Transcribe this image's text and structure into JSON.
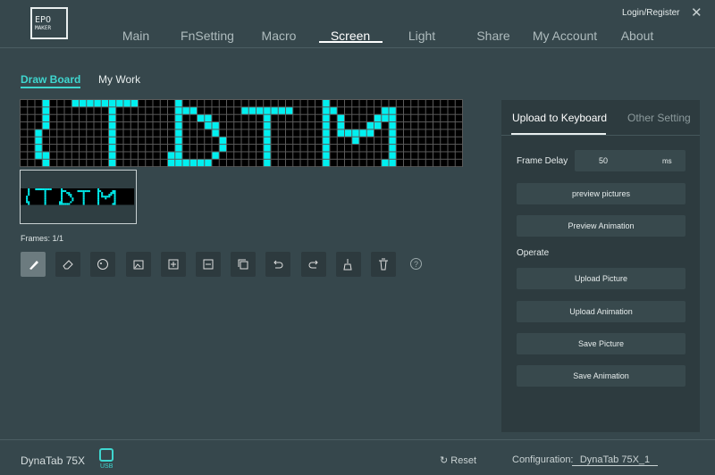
{
  "app": {
    "logo_text": [
      "EPO",
      "M",
      "MAKER"
    ],
    "login": "Login/Register",
    "close": "✕"
  },
  "nav": [
    "Main",
    "FnSetting",
    "Macro",
    "Screen",
    "Light",
    "Share",
    "My Account",
    "About"
  ],
  "nav_active": "Screen",
  "subtabs": {
    "draw": "Draw Board",
    "work": "My Work",
    "active": "Draw Board"
  },
  "canvas": {
    "cols": 60,
    "rows": 9,
    "on_color": "#00f0f0",
    "off_color": "#000000",
    "lit": [
      [
        3,
        7,
        8,
        9,
        10,
        11,
        12,
        13,
        14,
        15,
        21,
        41
      ],
      [
        3,
        12,
        21,
        22,
        23,
        30,
        31,
        32,
        33,
        34,
        35,
        36,
        41,
        42,
        49,
        50
      ],
      [
        3,
        12,
        21,
        24,
        25,
        33,
        41,
        43,
        48,
        49,
        50
      ],
      [
        3,
        12,
        21,
        25,
        26,
        33,
        41,
        43,
        47,
        48,
        50
      ],
      [
        2,
        12,
        21,
        26,
        33,
        41,
        43,
        44,
        45,
        46,
        47,
        50
      ],
      [
        2,
        12,
        21,
        27,
        33,
        41,
        45,
        50
      ],
      [
        2,
        12,
        21,
        27,
        33,
        41,
        50
      ],
      [
        2,
        3,
        12,
        20,
        21,
        26,
        33,
        41,
        50
      ],
      [
        3,
        12,
        20,
        21,
        22,
        23,
        24,
        25,
        33,
        41,
        49,
        50
      ]
    ]
  },
  "frames": "Frames: 1/1",
  "tools": [
    "brush",
    "eraser",
    "palette",
    "image",
    "add-frame",
    "remove-frame",
    "copy-frame",
    "undo",
    "redo",
    "clear",
    "delete"
  ],
  "tool_active": "brush",
  "help": "?",
  "panel": {
    "tabs": [
      "Upload to Keyboard",
      "Other Setting"
    ],
    "active_tab": "Upload to Keyboard",
    "frame_delay_label": "Frame Delay",
    "frame_delay_value": "50",
    "frame_delay_unit": "ms",
    "preview_pictures": "preview pictures",
    "preview_animation": "Preview Animation",
    "operate": "Operate",
    "upload_picture": "Upload Picture",
    "upload_animation": "Upload Animation",
    "save_picture": "Save Picture",
    "save_animation": "Save Animation"
  },
  "footer": {
    "device": "DynaTab 75X",
    "usb": "USB",
    "reset": "Reset",
    "config_label": "Configuration:",
    "config_value": "DynaTab 75X_1"
  },
  "colors": {
    "accent": "#3fd6cf",
    "background": "#36474c",
    "panel": "#2d3b3f"
  }
}
